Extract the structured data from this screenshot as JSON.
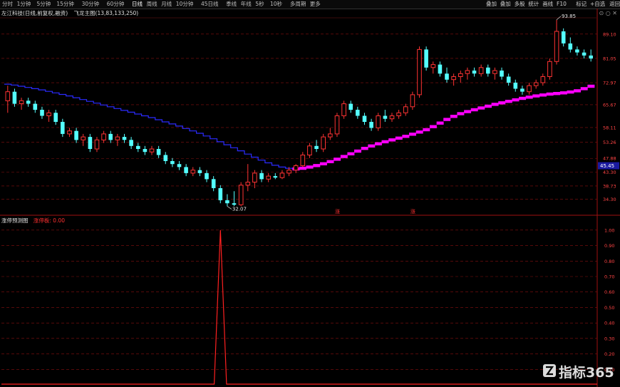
{
  "toolbar": {
    "tabs": [
      "分时",
      "1分钟",
      "5分钟",
      "15分钟",
      "30分钟",
      "60分钟",
      "日线",
      "周线",
      "月线",
      "10分钟",
      "45日线",
      "季线",
      "年线",
      "5秒",
      "10秒",
      "多周期",
      "更多"
    ],
    "active_tab": 6,
    "right_tabs": [
      "叠加",
      "叠加",
      "多股",
      "统计",
      "画线",
      "F10",
      "标记",
      "+自选",
      "返回"
    ]
  },
  "stock_header": {
    "name": "左江科技(日线,前复权,融资)",
    "indicator": "飞龙主图(13,83,133,250)"
  },
  "indicator_header": {
    "name": "涨停预测图",
    "value": "涨停板: 0.00"
  },
  "window_controls": "⊙ ○ ✕",
  "price_axis": {
    "labels": [
      "89.10",
      "81.05",
      "72.97",
      "65.67",
      "58.11",
      "53.26",
      "47.88",
      "43.30",
      "38.73",
      "34.30"
    ],
    "current_price": "45.45"
  },
  "indicator_axis": {
    "labels": [
      "1.00",
      "0.90",
      "0.80",
      "0.70",
      "0.60",
      "0.50",
      "0.40",
      "0.30",
      "0.20",
      "0.10"
    ]
  },
  "annotations": {
    "high": "93.85",
    "low": "32.07",
    "markers": [
      "涨",
      "涨"
    ]
  },
  "colors": {
    "up": "#ff3333",
    "down": "#54ffff",
    "ma_blue": "#2b2bff",
    "ma_magenta": "#ff00ff",
    "grid": "#8a1010",
    "signal": "#ff2020"
  },
  "chart_data": {
    "type": "candlestick",
    "price_range": [
      29.5,
      94.5
    ],
    "candles": [
      {
        "o": 67,
        "h": 72,
        "l": 63,
        "c": 70
      },
      {
        "o": 70,
        "h": 71,
        "l": 65,
        "c": 66
      },
      {
        "o": 66,
        "h": 68,
        "l": 64,
        "c": 67
      },
      {
        "o": 67,
        "h": 68,
        "l": 65,
        "c": 66
      },
      {
        "o": 66,
        "h": 67,
        "l": 63,
        "c": 64
      },
      {
        "o": 64,
        "h": 65,
        "l": 61,
        "c": 62
      },
      {
        "o": 62,
        "h": 64,
        "l": 60,
        "c": 63
      },
      {
        "o": 63,
        "h": 64,
        "l": 59,
        "c": 60
      },
      {
        "o": 60,
        "h": 61,
        "l": 55,
        "c": 56
      },
      {
        "o": 56,
        "h": 58,
        "l": 55,
        "c": 57
      },
      {
        "o": 57,
        "h": 58,
        "l": 53,
        "c": 54
      },
      {
        "o": 54,
        "h": 56,
        "l": 52,
        "c": 55
      },
      {
        "o": 55,
        "h": 56,
        "l": 50,
        "c": 51
      },
      {
        "o": 51,
        "h": 55,
        "l": 50,
        "c": 54
      },
      {
        "o": 54,
        "h": 57,
        "l": 53,
        "c": 56
      },
      {
        "o": 56,
        "h": 57,
        "l": 53,
        "c": 54
      },
      {
        "o": 54,
        "h": 56,
        "l": 52,
        "c": 55
      },
      {
        "o": 55,
        "h": 56,
        "l": 53,
        "c": 54
      },
      {
        "o": 54,
        "h": 55,
        "l": 51,
        "c": 52
      },
      {
        "o": 52,
        "h": 53,
        "l": 50,
        "c": 51
      },
      {
        "o": 51,
        "h": 52,
        "l": 49,
        "c": 50
      },
      {
        "o": 50,
        "h": 52,
        "l": 49,
        "c": 51
      },
      {
        "o": 51,
        "h": 52,
        "l": 48,
        "c": 49
      },
      {
        "o": 49,
        "h": 50,
        "l": 46,
        "c": 47
      },
      {
        "o": 47,
        "h": 48,
        "l": 45,
        "c": 46
      },
      {
        "o": 46,
        "h": 47,
        "l": 44,
        "c": 45
      },
      {
        "o": 45,
        "h": 46,
        "l": 42,
        "c": 43
      },
      {
        "o": 43,
        "h": 45,
        "l": 42,
        "c": 44
      },
      {
        "o": 44,
        "h": 45,
        "l": 42,
        "c": 43
      },
      {
        "o": 43,
        "h": 44,
        "l": 40,
        "c": 41
      },
      {
        "o": 41,
        "h": 42,
        "l": 37,
        "c": 38
      },
      {
        "o": 38,
        "h": 39,
        "l": 33,
        "c": 34
      },
      {
        "o": 34,
        "h": 36,
        "l": 32,
        "c": 33
      },
      {
        "o": 33,
        "h": 37,
        "l": 32.07,
        "c": 32.5
      },
      {
        "o": 32.5,
        "h": 40,
        "l": 32,
        "c": 39
      },
      {
        "o": 39,
        "h": 46,
        "l": 37,
        "c": 40
      },
      {
        "o": 40,
        "h": 44,
        "l": 38,
        "c": 43
      },
      {
        "o": 43,
        "h": 44,
        "l": 40,
        "c": 41
      },
      {
        "o": 41,
        "h": 43,
        "l": 40,
        "c": 42
      },
      {
        "o": 42,
        "h": 43,
        "l": 41,
        "c": 41.5
      },
      {
        "o": 41.5,
        "h": 44,
        "l": 41,
        "c": 43
      },
      {
        "o": 43,
        "h": 45,
        "l": 42,
        "c": 44
      },
      {
        "o": 44,
        "h": 46,
        "l": 43,
        "c": 45.45
      },
      {
        "o": 45.45,
        "h": 50,
        "l": 45,
        "c": 49
      },
      {
        "o": 49,
        "h": 53,
        "l": 48,
        "c": 52
      },
      {
        "o": 52,
        "h": 54,
        "l": 50,
        "c": 51
      },
      {
        "o": 51,
        "h": 56,
        "l": 50,
        "c": 55
      },
      {
        "o": 55,
        "h": 58,
        "l": 54,
        "c": 56
      },
      {
        "o": 56,
        "h": 63,
        "l": 55,
        "c": 62
      },
      {
        "o": 62,
        "h": 67,
        "l": 61,
        "c": 66
      },
      {
        "o": 66,
        "h": 67,
        "l": 63,
        "c": 64
      },
      {
        "o": 64,
        "h": 65,
        "l": 61,
        "c": 62
      },
      {
        "o": 62,
        "h": 63,
        "l": 59,
        "c": 60
      },
      {
        "o": 60,
        "h": 61,
        "l": 57,
        "c": 58
      },
      {
        "o": 58,
        "h": 63,
        "l": 57,
        "c": 62
      },
      {
        "o": 62,
        "h": 64,
        "l": 60,
        "c": 61
      },
      {
        "o": 61,
        "h": 63,
        "l": 60,
        "c": 62
      },
      {
        "o": 62,
        "h": 64,
        "l": 61,
        "c": 63
      },
      {
        "o": 63,
        "h": 66,
        "l": 62,
        "c": 65
      },
      {
        "o": 65,
        "h": 70,
        "l": 64,
        "c": 69
      },
      {
        "o": 69,
        "h": 85,
        "l": 68,
        "c": 84
      },
      {
        "o": 84,
        "h": 85,
        "l": 77,
        "c": 78
      },
      {
        "o": 78,
        "h": 80,
        "l": 76,
        "c": 79
      },
      {
        "o": 79,
        "h": 80,
        "l": 75,
        "c": 76
      },
      {
        "o": 76,
        "h": 78,
        "l": 73,
        "c": 74
      },
      {
        "o": 74,
        "h": 76,
        "l": 72,
        "c": 75
      },
      {
        "o": 75,
        "h": 77,
        "l": 73,
        "c": 76
      },
      {
        "o": 76,
        "h": 78,
        "l": 74,
        "c": 77
      },
      {
        "o": 77,
        "h": 78,
        "l": 75,
        "c": 76
      },
      {
        "o": 76,
        "h": 79,
        "l": 75,
        "c": 78
      },
      {
        "o": 78,
        "h": 79,
        "l": 75,
        "c": 76
      },
      {
        "o": 76,
        "h": 78,
        "l": 74,
        "c": 77
      },
      {
        "o": 77,
        "h": 78,
        "l": 74,
        "c": 75
      },
      {
        "o": 75,
        "h": 76,
        "l": 72,
        "c": 73
      },
      {
        "o": 73,
        "h": 74,
        "l": 70,
        "c": 71
      },
      {
        "o": 71,
        "h": 72,
        "l": 69,
        "c": 70
      },
      {
        "o": 70,
        "h": 73,
        "l": 69,
        "c": 72
      },
      {
        "o": 72,
        "h": 74,
        "l": 71,
        "c": 73
      },
      {
        "o": 73,
        "h": 76,
        "l": 72,
        "c": 75
      },
      {
        "o": 75,
        "h": 81,
        "l": 74,
        "c": 80
      },
      {
        "o": 80,
        "h": 93.85,
        "l": 79,
        "c": 90
      },
      {
        "o": 90,
        "h": 91,
        "l": 85,
        "c": 86
      },
      {
        "o": 86,
        "h": 88,
        "l": 83,
        "c": 84
      },
      {
        "o": 84,
        "h": 85,
        "l": 82,
        "c": 83
      },
      {
        "o": 83,
        "h": 84,
        "l": 81,
        "c": 82
      },
      {
        "o": 82,
        "h": 84,
        "l": 80,
        "c": 81
      }
    ],
    "ma_blue": [
      72.5,
      72.2,
      71.8,
      71.4,
      71,
      70.6,
      70.1,
      69.6,
      69.1,
      68.6,
      68,
      67.4,
      66.8,
      66.2,
      65.6,
      65,
      64.4,
      63.8,
      63.2,
      62.6,
      62,
      61.4,
      60.7,
      60,
      59.3,
      58.6,
      57.8,
      57,
      56.2,
      55.3,
      54.4,
      53.4,
      52.4,
      51.4,
      50.4,
      49.3,
      48.3,
      47.3,
      46.4,
      45.6,
      45,
      44.6,
      44.4
    ],
    "ma_magenta_start": 42,
    "ma_magenta": [
      44.4,
      44.6,
      45,
      45.5,
      46.1,
      46.8,
      47.6,
      48.5,
      49.4,
      50.3,
      51.2,
      52,
      52.7,
      53.4,
      54,
      54.6,
      55.2,
      55.9,
      56.6,
      57.4,
      58.4,
      59.6,
      60.8,
      61.8,
      62.7,
      63.4,
      64,
      64.6,
      65.2,
      65.8,
      66.3,
      66.8,
      67.3,
      67.8,
      68.2,
      68.6,
      68.9,
      69.2,
      69.4,
      69.6,
      69.9,
      70.3,
      71,
      71.8,
      72.7,
      73.5,
      74.1,
      74.6
    ],
    "signal_index": 31,
    "signal_value": 1.0,
    "indicator_range": [
      0,
      1.05
    ]
  }
}
